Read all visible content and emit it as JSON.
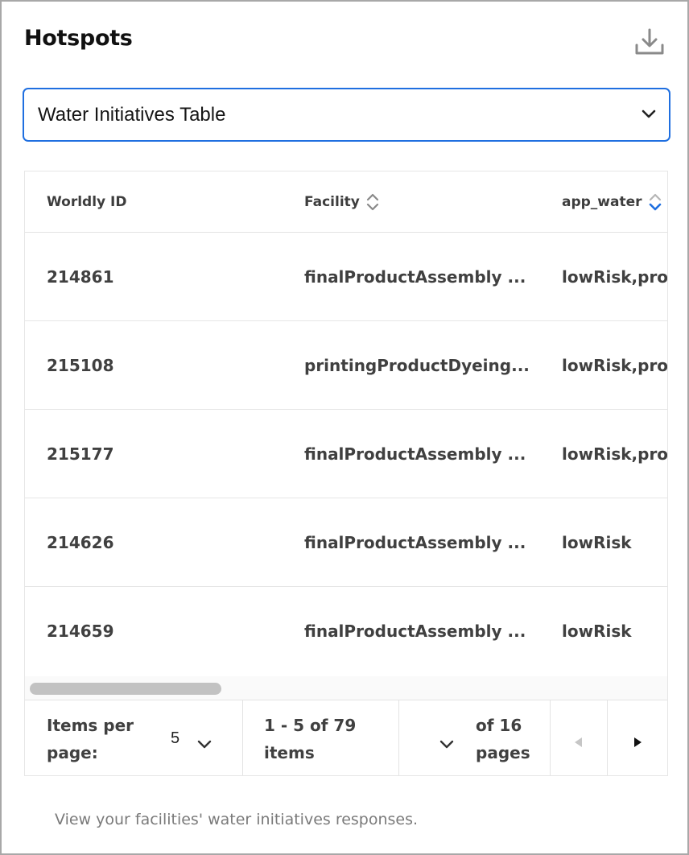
{
  "card": {
    "title": "Hotspots",
    "footer_note": "View your facilities' water initiatives responses."
  },
  "icons": {
    "download": "download-icon",
    "select_chevron": "chevron-down-icon",
    "sort": "sort-icon",
    "prev": "caret-left-icon",
    "next": "caret-right-icon"
  },
  "dropdown": {
    "selected": "Water Initiatives Table"
  },
  "table": {
    "headers": [
      "Worldly ID",
      "Facility",
      "app_water"
    ],
    "rows": [
      [
        "214861",
        "finalProductAssembly ...",
        "lowRisk,prod"
      ],
      [
        "215108",
        "printingProductDyeing...",
        "lowRisk,prod"
      ],
      [
        "215177",
        "finalProductAssembly ...",
        "lowRisk,prod"
      ],
      [
        "214626",
        "finalProductAssembly ...",
        "lowRisk"
      ],
      [
        "214659",
        "finalProductAssembly ...",
        "lowRisk"
      ]
    ]
  },
  "pagination": {
    "items_per_page_label_1": "Items per",
    "items_per_page_label_2": "page:",
    "items_per_page_value": "5",
    "range_1": "1 - 5 of 79",
    "range_2": "items",
    "of_pages_1": "of 16",
    "of_pages_2": "pages"
  },
  "colors": {
    "accent": "#1f6fe0",
    "border": "#a8a8a8",
    "text": "#404040",
    "muted": "#7a7a7a"
  }
}
